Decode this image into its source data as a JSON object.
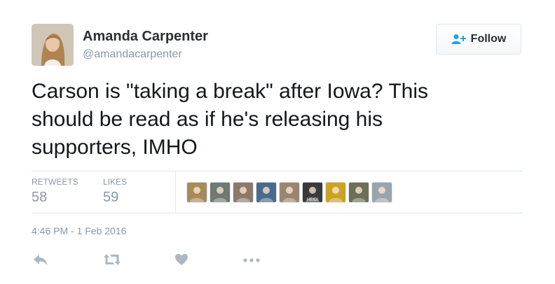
{
  "user": {
    "name": "Amanda Carpenter",
    "handle": "@amandacarpenter"
  },
  "follow_button": {
    "label": "Follow",
    "icon": "add-user-icon"
  },
  "tweet": {
    "text": "Carson is \"taking a break\" after Iowa? This\nshould be read as if he's releasing his\nsupporters, IMHO",
    "timestamp": "4:46 PM - 1 Feb 2016"
  },
  "stats": {
    "retweets_label": "RETWEETS",
    "retweets_value": "58",
    "likes_label": "LIKES",
    "likes_value": "59"
  },
  "likers": [
    {
      "icon": "liker-avatar",
      "color": "#a88b5a"
    },
    {
      "icon": "liker-avatar",
      "color": "#6e7a72"
    },
    {
      "icon": "liker-avatar",
      "color": "#8a7a6a"
    },
    {
      "icon": "liker-avatar",
      "color": "#4a6a8a"
    },
    {
      "icon": "liker-avatar",
      "color": "#9a8670"
    },
    {
      "icon": "liker-avatar",
      "color": "#3a3a3a",
      "text": "HEIDI"
    },
    {
      "icon": "liker-avatar",
      "color": "#c9a227"
    },
    {
      "icon": "liker-avatar",
      "color": "#6b6f55"
    },
    {
      "icon": "liker-avatar",
      "color": "#9aa4ad"
    }
  ],
  "actions": {
    "reply_icon": "reply-icon",
    "retweet_icon": "retweet-icon",
    "like_icon": "heart-icon",
    "more_icon": "more-icon"
  },
  "colors": {
    "muted": "#8899a6",
    "border": "#e1e8ed",
    "follow_accent": "#1da1f2",
    "text": "#14171a"
  }
}
